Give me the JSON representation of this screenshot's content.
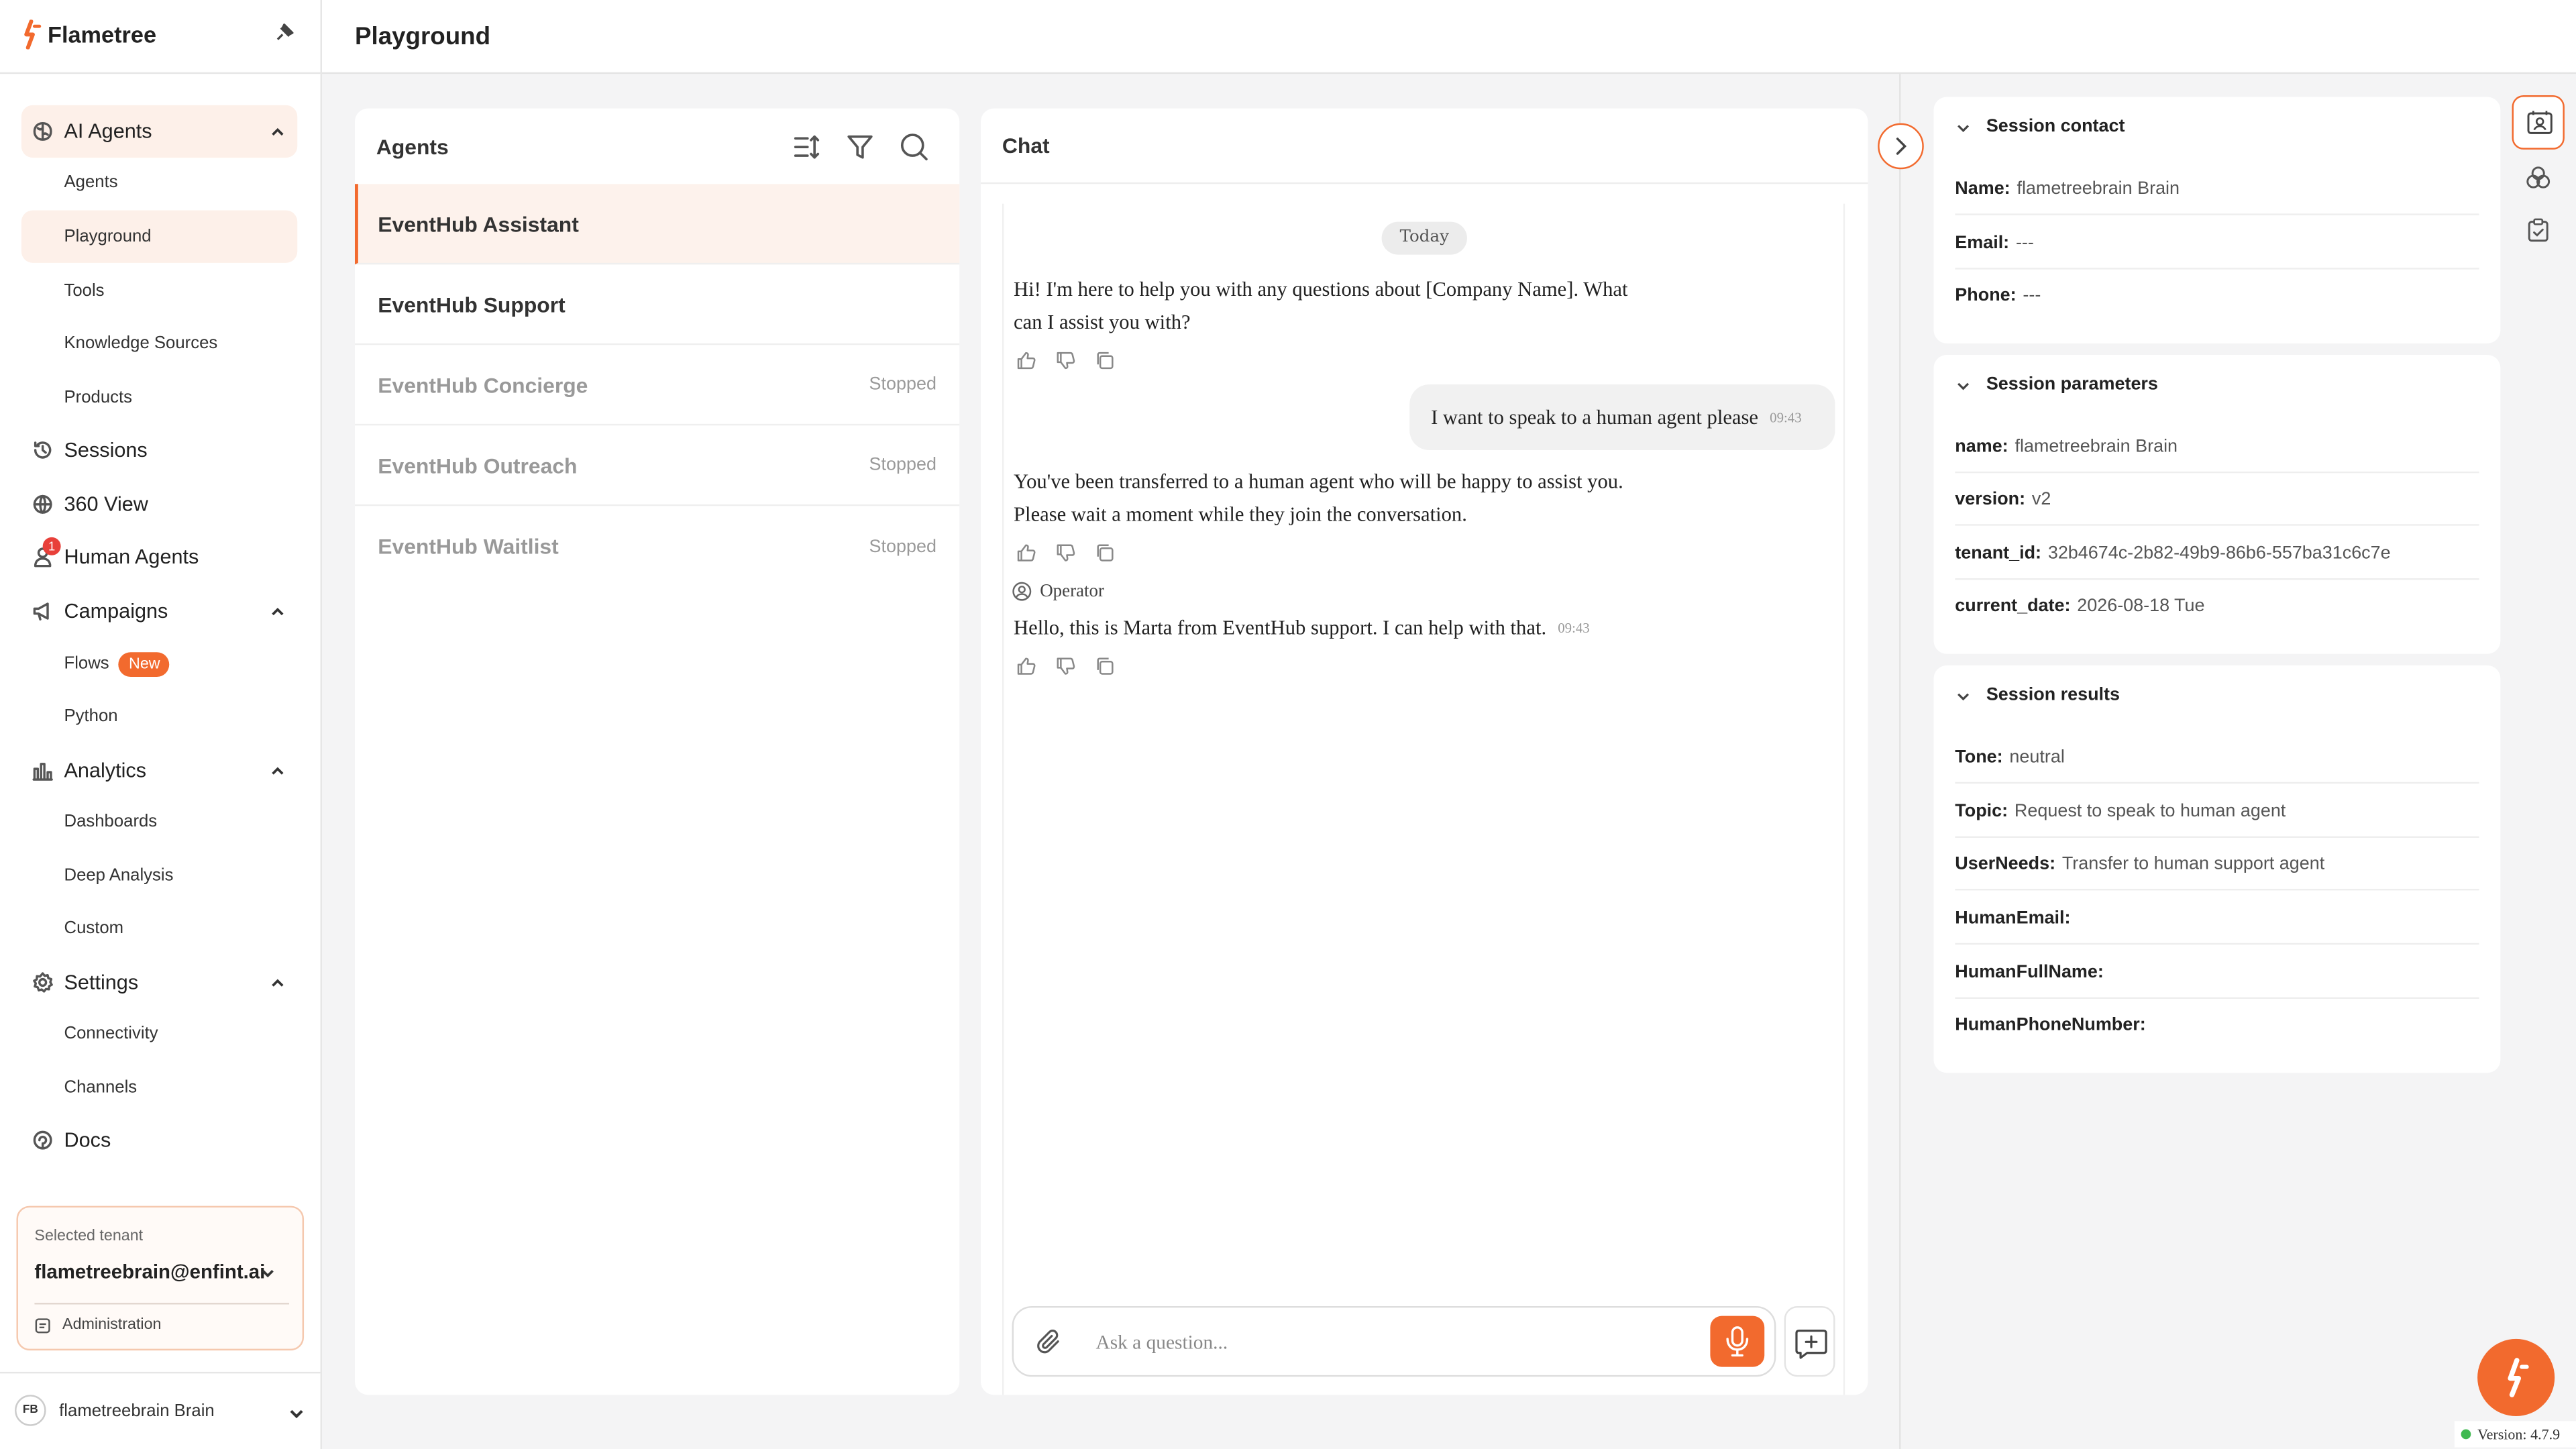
{
  "app": {
    "brand_name": "Flametree",
    "page_title": "Playground",
    "accent_color": "#f26a2e"
  },
  "sidebar": {
    "sections": [
      {
        "label": "AI Agents",
        "icon": "brain-icon",
        "expanded": true,
        "items": [
          {
            "label": "Agents"
          },
          {
            "label": "Playground",
            "active": true
          },
          {
            "label": "Tools"
          },
          {
            "label": "Knowledge Sources"
          },
          {
            "label": "Products"
          }
        ]
      },
      {
        "label": "Sessions",
        "icon": "history-icon"
      },
      {
        "label": "360 View",
        "icon": "globe-icon"
      },
      {
        "label": "Human Agents",
        "icon": "person-icon",
        "badge": "1"
      },
      {
        "label": "Campaigns",
        "icon": "megaphone-icon",
        "expanded": true,
        "items": [
          {
            "label": "Flows",
            "badge": "New"
          },
          {
            "label": "Python"
          }
        ]
      },
      {
        "label": "Analytics",
        "icon": "bar-chart-icon",
        "expanded": true,
        "items": [
          {
            "label": "Dashboards"
          },
          {
            "label": "Deep Analysis"
          },
          {
            "label": "Custom"
          }
        ]
      },
      {
        "label": "Settings",
        "icon": "gear-icon",
        "expanded": true,
        "items": [
          {
            "label": "Connectivity"
          },
          {
            "label": "Channels"
          }
        ]
      },
      {
        "label": "Docs",
        "icon": "docs-icon"
      }
    ],
    "tenant": {
      "label": "Selected tenant",
      "value": "flametreebrain@enfint.ai",
      "admin_label": "Administration"
    },
    "user": {
      "initials": "FB",
      "name": "flametreebrain Brain"
    }
  },
  "agents_panel": {
    "title": "Agents",
    "agents": [
      {
        "name": "EventHub Assistant",
        "status": "",
        "active": true
      },
      {
        "name": "EventHub Support",
        "status": ""
      },
      {
        "name": "EventHub Concierge",
        "status": "Stopped"
      },
      {
        "name": "EventHub Outreach",
        "status": "Stopped"
      },
      {
        "name": "EventHub Waitlist",
        "status": "Stopped"
      }
    ]
  },
  "chat": {
    "title": "Chat",
    "date_divider": "Today",
    "messages": [
      {
        "role": "bot",
        "lines": [
          "Hi! I'm here to help you with any questions about [Company Name]. What",
          "can I assist you with?"
        ]
      },
      {
        "role": "user",
        "text": "I want to speak to a human agent please",
        "time": "09:43"
      },
      {
        "role": "bot",
        "lines": [
          "You've been transferred to a human agent who will be happy to assist you.",
          "Please wait a moment while they join the conversation."
        ]
      },
      {
        "role": "operator",
        "author": "Operator",
        "text": "Hello, this is Marta from EventHub support. I can help with that.",
        "time": "09:43"
      }
    ],
    "input_placeholder": "Ask a question..."
  },
  "session_contact": {
    "title": "Session contact",
    "fields": [
      {
        "key": "Name:",
        "value": "flametreebrain Brain"
      },
      {
        "key": "Email:",
        "value": "---"
      },
      {
        "key": "Phone:",
        "value": "---"
      }
    ]
  },
  "session_parameters": {
    "title": "Session parameters",
    "fields": [
      {
        "key": "name:",
        "value": "flametreebrain Brain"
      },
      {
        "key": "version:",
        "value": "v2"
      },
      {
        "key": "tenant_id:",
        "value": "32b4674c-2b82-49b9-86b6-557ba31c6c7e"
      },
      {
        "key": "current_date:",
        "value": "2026-08-18 Tue"
      }
    ]
  },
  "session_results": {
    "title": "Session results",
    "fields": [
      {
        "key": "Tone:",
        "value": "neutral"
      },
      {
        "key": "Topic:",
        "value": "Request to speak to human agent"
      },
      {
        "key": "UserNeeds:",
        "value": "Transfer to human support agent"
      },
      {
        "key": "HumanEmail:",
        "value": ""
      },
      {
        "key": "HumanFullName:",
        "value": ""
      },
      {
        "key": "HumanPhoneNumber:",
        "value": ""
      }
    ]
  },
  "footer": {
    "version": "Version: 4.7.9"
  }
}
